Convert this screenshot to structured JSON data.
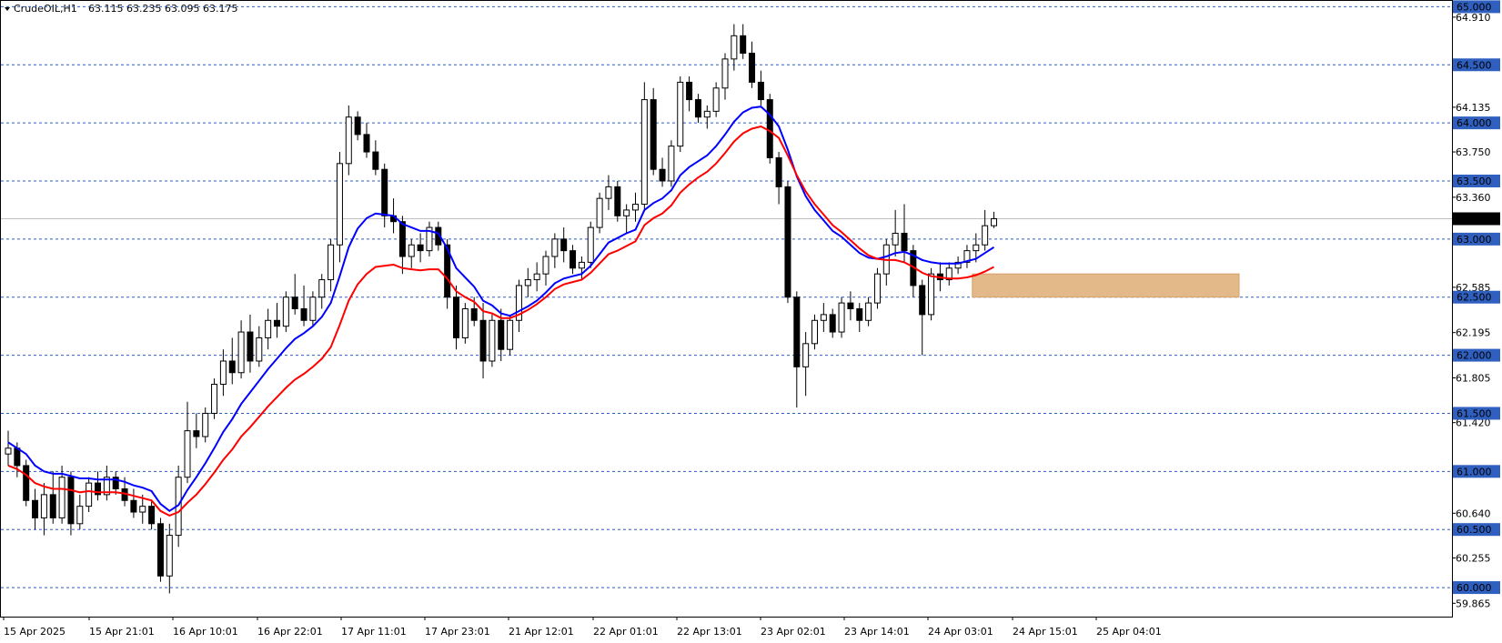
{
  "symbol_label": "CrudeOIL,H1",
  "ohlc_label": "63.115 63.235 63.095 63.175",
  "colors": {
    "ema_fast": "#0000ff",
    "ema_slow": "#ff0000",
    "level_line": "#2f5fbf",
    "level_tag_bg": "#2f5fbf",
    "last_price_tag_bg": "#000000",
    "zone_fill": "#e3b98a"
  },
  "chart_data": {
    "type": "candlestick",
    "title": "",
    "ylim": [
      59.75,
      65.05
    ],
    "y_axis_ticks": [
      "64.910",
      "64.135",
      "63.750",
      "63.360",
      "62.585",
      "62.195",
      "61.805",
      "61.420",
      "60.640",
      "60.255",
      "59.865"
    ],
    "x_axis_labels": [
      "15 Apr 2025",
      "15 Apr 21:01",
      "16 Apr 10:01",
      "16 Apr 22:01",
      "17 Apr 11:01",
      "17 Apr 23:01",
      "21 Apr 12:01",
      "22 Apr 01:01",
      "22 Apr 13:01",
      "23 Apr 02:01",
      "23 Apr 14:01",
      "24 Apr 03:01",
      "24 Apr 15:01",
      "25 Apr 04:01"
    ],
    "horizontal_levels": [
      "65.000",
      "64.500",
      "64.000",
      "63.500",
      "63.000",
      "62.500",
      "62.000",
      "61.500",
      "61.000",
      "60.500",
      "60.000"
    ],
    "last_price": "63.175",
    "zone": {
      "from": 62.5,
      "to": 62.7
    },
    "candles": [
      [
        61.15,
        61.35,
        61.05,
        61.2
      ],
      [
        61.2,
        61.25,
        60.95,
        61.05
      ],
      [
        61.05,
        61.1,
        60.7,
        60.75
      ],
      [
        60.75,
        60.85,
        60.5,
        60.6
      ],
      [
        60.6,
        60.9,
        60.45,
        60.8
      ],
      [
        60.8,
        61.0,
        60.55,
        60.6
      ],
      [
        60.6,
        61.05,
        60.55,
        60.95
      ],
      [
        60.95,
        61.0,
        60.45,
        60.55
      ],
      [
        60.55,
        60.8,
        60.5,
        60.7
      ],
      [
        60.7,
        60.95,
        60.65,
        60.9
      ],
      [
        60.9,
        61.0,
        60.75,
        60.8
      ],
      [
        60.8,
        61.05,
        60.75,
        60.95
      ],
      [
        60.95,
        61.0,
        60.8,
        60.85
      ],
      [
        60.85,
        60.95,
        60.7,
        60.75
      ],
      [
        60.75,
        60.85,
        60.6,
        60.65
      ],
      [
        60.65,
        60.8,
        60.55,
        60.7
      ],
      [
        60.7,
        60.75,
        60.5,
        60.55
      ],
      [
        60.55,
        60.6,
        60.05,
        60.1
      ],
      [
        60.1,
        60.55,
        59.95,
        60.45
      ],
      [
        60.45,
        61.05,
        60.35,
        60.95
      ],
      [
        60.95,
        61.6,
        60.9,
        61.35
      ],
      [
        61.35,
        61.5,
        61.2,
        61.3
      ],
      [
        61.3,
        61.55,
        61.25,
        61.5
      ],
      [
        61.5,
        61.8,
        61.45,
        61.75
      ],
      [
        61.75,
        62.05,
        61.65,
        61.95
      ],
      [
        61.95,
        62.15,
        61.75,
        61.85
      ],
      [
        61.85,
        62.3,
        61.8,
        62.2
      ],
      [
        62.2,
        62.35,
        61.85,
        61.95
      ],
      [
        61.95,
        62.25,
        61.9,
        62.15
      ],
      [
        62.15,
        62.4,
        62.05,
        62.3
      ],
      [
        62.3,
        62.45,
        62.15,
        62.25
      ],
      [
        62.25,
        62.55,
        62.2,
        62.5
      ],
      [
        62.5,
        62.7,
        62.35,
        62.4
      ],
      [
        62.4,
        62.6,
        62.25,
        62.3
      ],
      [
        62.3,
        62.55,
        62.25,
        62.5
      ],
      [
        62.5,
        62.7,
        62.4,
        62.65
      ],
      [
        62.65,
        63.0,
        62.55,
        62.95
      ],
      [
        62.95,
        63.75,
        62.8,
        63.65
      ],
      [
        63.65,
        64.15,
        63.55,
        64.05
      ],
      [
        64.05,
        64.1,
        63.85,
        63.9
      ],
      [
        63.9,
        64.0,
        63.7,
        63.75
      ],
      [
        63.75,
        63.85,
        63.55,
        63.6
      ],
      [
        63.6,
        63.65,
        63.1,
        63.2
      ],
      [
        63.2,
        63.35,
        63.05,
        63.15
      ],
      [
        63.15,
        63.2,
        62.7,
        62.85
      ],
      [
        62.85,
        63.0,
        62.75,
        62.95
      ],
      [
        62.95,
        63.05,
        62.8,
        62.9
      ],
      [
        62.9,
        63.15,
        62.85,
        63.1
      ],
      [
        63.1,
        63.15,
        62.9,
        62.95
      ],
      [
        62.95,
        63.0,
        62.4,
        62.5
      ],
      [
        62.5,
        62.6,
        62.05,
        62.15
      ],
      [
        62.15,
        62.45,
        62.1,
        62.4
      ],
      [
        62.4,
        62.5,
        62.25,
        62.3
      ],
      [
        62.3,
        62.45,
        61.8,
        61.95
      ],
      [
        61.95,
        62.35,
        61.9,
        62.3
      ],
      [
        62.3,
        62.4,
        61.95,
        62.05
      ],
      [
        62.05,
        62.35,
        62.0,
        62.3
      ],
      [
        62.3,
        62.65,
        62.2,
        62.6
      ],
      [
        62.6,
        62.75,
        62.5,
        62.65
      ],
      [
        62.65,
        62.8,
        62.55,
        62.7
      ],
      [
        62.7,
        62.9,
        62.6,
        62.85
      ],
      [
        62.85,
        63.05,
        62.75,
        63.0
      ],
      [
        63.0,
        63.1,
        62.8,
        62.9
      ],
      [
        62.9,
        62.95,
        62.7,
        62.75
      ],
      [
        62.75,
        62.85,
        62.65,
        62.8
      ],
      [
        62.8,
        63.15,
        62.75,
        63.1
      ],
      [
        63.1,
        63.4,
        63.05,
        63.35
      ],
      [
        63.35,
        63.55,
        63.25,
        63.45
      ],
      [
        63.45,
        63.5,
        63.15,
        63.2
      ],
      [
        63.2,
        63.3,
        63.05,
        63.25
      ],
      [
        63.25,
        63.4,
        63.15,
        63.3
      ],
      [
        63.3,
        64.35,
        63.25,
        64.2
      ],
      [
        64.2,
        64.3,
        63.55,
        63.6
      ],
      [
        63.6,
        63.7,
        63.45,
        63.5
      ],
      [
        63.5,
        63.85,
        63.45,
        63.8
      ],
      [
        63.8,
        64.4,
        63.75,
        64.35
      ],
      [
        64.35,
        64.4,
        64.1,
        64.2
      ],
      [
        64.2,
        64.25,
        64.0,
        64.05
      ],
      [
        64.05,
        64.15,
        63.95,
        64.1
      ],
      [
        64.1,
        64.35,
        64.05,
        64.3
      ],
      [
        64.3,
        64.6,
        64.2,
        64.55
      ],
      [
        64.55,
        64.85,
        64.45,
        64.75
      ],
      [
        64.75,
        64.85,
        64.55,
        64.6
      ],
      [
        64.6,
        64.7,
        64.3,
        64.35
      ],
      [
        64.35,
        64.45,
        64.15,
        64.2
      ],
      [
        64.2,
        64.25,
        63.65,
        63.7
      ],
      [
        63.7,
        63.75,
        63.3,
        63.45
      ],
      [
        63.45,
        63.5,
        62.45,
        62.5
      ],
      [
        62.5,
        62.55,
        61.55,
        61.9
      ],
      [
        61.9,
        62.2,
        61.65,
        62.1
      ],
      [
        62.1,
        62.35,
        62.05,
        62.3
      ],
      [
        62.3,
        62.45,
        62.2,
        62.35
      ],
      [
        62.35,
        62.4,
        62.15,
        62.2
      ],
      [
        62.2,
        62.5,
        62.15,
        62.45
      ],
      [
        62.45,
        62.55,
        62.3,
        62.4
      ],
      [
        62.4,
        62.45,
        62.2,
        62.3
      ],
      [
        62.3,
        62.5,
        62.25,
        62.45
      ],
      [
        62.45,
        62.75,
        62.4,
        62.7
      ],
      [
        62.7,
        63.0,
        62.6,
        62.95
      ],
      [
        62.95,
        63.25,
        62.85,
        63.05
      ],
      [
        63.05,
        63.3,
        62.8,
        62.9
      ],
      [
        62.9,
        62.95,
        62.5,
        62.6
      ],
      [
        62.6,
        62.65,
        62.0,
        62.35
      ],
      [
        62.35,
        62.75,
        62.3,
        62.7
      ],
      [
        62.7,
        62.8,
        62.55,
        62.65
      ],
      [
        62.65,
        62.8,
        62.6,
        62.75
      ],
      [
        62.75,
        62.85,
        62.7,
        62.8
      ],
      [
        62.8,
        62.95,
        62.75,
        62.9
      ],
      [
        62.9,
        63.05,
        62.8,
        62.95
      ],
      [
        62.95,
        63.25,
        62.9,
        63.115
      ],
      [
        63.115,
        63.235,
        63.095,
        63.175
      ]
    ],
    "series": [
      {
        "type": "line",
        "color": "ema_fast",
        "values": [
          61.25,
          61.2,
          61.15,
          61.05,
          61.0,
          60.98,
          60.98,
          60.96,
          60.94,
          60.94,
          60.93,
          60.93,
          60.93,
          60.91,
          60.88,
          60.86,
          60.83,
          60.72,
          60.66,
          60.71,
          60.84,
          60.95,
          61.07,
          61.2,
          61.34,
          61.45,
          61.58,
          61.68,
          61.78,
          61.88,
          61.97,
          62.06,
          62.14,
          62.19,
          62.25,
          62.33,
          62.45,
          62.68,
          62.93,
          63.09,
          63.18,
          63.22,
          63.21,
          63.2,
          63.13,
          63.1,
          63.07,
          63.07,
          63.05,
          62.92,
          62.75,
          62.67,
          62.59,
          62.47,
          62.43,
          62.36,
          62.34,
          62.38,
          62.42,
          62.47,
          62.54,
          62.62,
          62.66,
          62.68,
          62.7,
          62.77,
          62.87,
          62.97,
          63.01,
          63.05,
          63.08,
          63.25,
          63.31,
          63.35,
          63.42,
          63.55,
          63.62,
          63.67,
          63.72,
          63.8,
          63.9,
          64.01,
          64.09,
          64.13,
          64.14,
          64.07,
          63.97,
          63.77,
          63.54,
          63.37,
          63.25,
          63.16,
          63.07,
          63.02,
          62.95,
          62.88,
          62.84,
          62.83,
          62.85,
          62.88,
          62.89,
          62.86,
          62.82,
          62.8,
          62.79,
          62.79,
          62.79,
          62.81,
          62.83,
          62.88,
          62.93
        ]
      },
      {
        "type": "line",
        "color": "ema_slow",
        "values": [
          61.05,
          61.02,
          60.97,
          60.9,
          60.87,
          60.85,
          60.85,
          60.84,
          60.82,
          60.83,
          60.82,
          60.82,
          60.82,
          60.81,
          60.79,
          60.77,
          60.75,
          60.66,
          60.62,
          60.65,
          60.73,
          60.8,
          60.89,
          60.99,
          61.1,
          61.19,
          61.3,
          61.38,
          61.47,
          61.56,
          61.64,
          61.72,
          61.79,
          61.84,
          61.9,
          61.97,
          62.07,
          62.26,
          62.47,
          62.61,
          62.7,
          62.76,
          62.77,
          62.78,
          62.75,
          62.74,
          62.73,
          62.74,
          62.74,
          62.66,
          62.55,
          62.5,
          62.46,
          62.38,
          62.36,
          62.32,
          62.32,
          62.35,
          62.39,
          62.44,
          62.5,
          62.57,
          62.61,
          62.63,
          62.65,
          62.71,
          62.79,
          62.87,
          62.9,
          62.94,
          62.98,
          63.12,
          63.18,
          63.22,
          63.29,
          63.4,
          63.47,
          63.53,
          63.58,
          63.65,
          63.74,
          63.84,
          63.91,
          63.95,
          63.97,
          63.93,
          63.87,
          63.72,
          63.55,
          63.41,
          63.3,
          63.21,
          63.12,
          63.06,
          62.99,
          62.92,
          62.86,
          62.83,
          62.82,
          62.82,
          62.8,
          62.76,
          62.71,
          62.68,
          62.67,
          62.66,
          62.66,
          62.67,
          62.69,
          62.72,
          62.76
        ]
      }
    ]
  }
}
